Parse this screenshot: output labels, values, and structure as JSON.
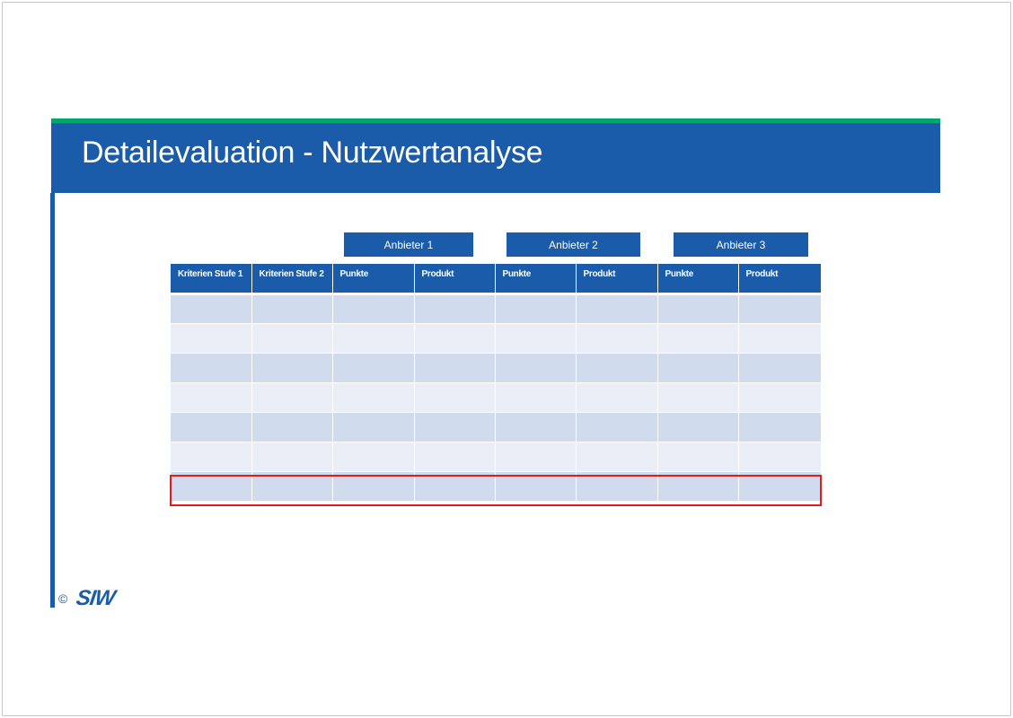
{
  "slide": {
    "title": "Detailevaluation - Nutzwertanalyse"
  },
  "vendors": [
    "Anbieter 1",
    "Anbieter 2",
    "Anbieter 3"
  ],
  "table": {
    "headers": [
      "Kriterien Stufe 1",
      "Kriterien Stufe 2",
      "Punkte",
      "Produkt",
      "Punkte",
      "Produkt",
      "Punkte",
      "Produkt"
    ],
    "row_count": 7,
    "highlighted_row": 7
  },
  "footer": {
    "copyright_symbol": "©",
    "logo_text": "SIW"
  },
  "colors": {
    "primary_blue": "#1b5caa",
    "accent_green": "#00a86b",
    "row_dark": "#d0dcee",
    "row_light": "#e9eef7",
    "highlight_red": "#e41b1b"
  }
}
